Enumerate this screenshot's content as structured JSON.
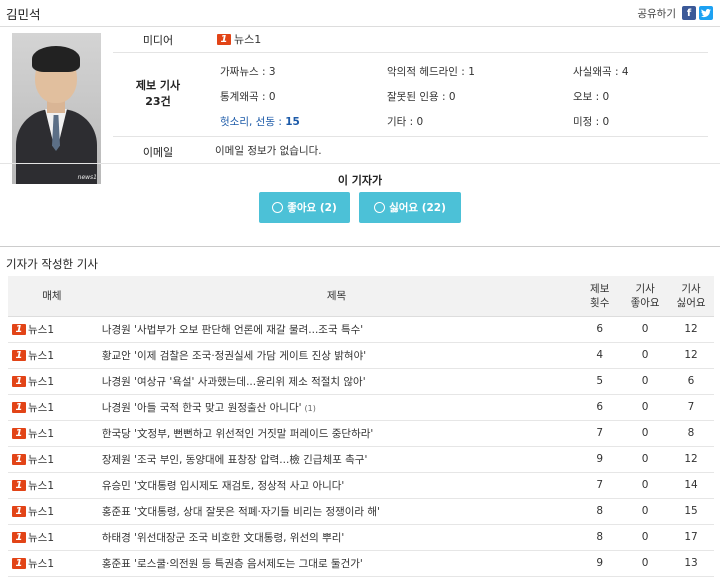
{
  "reporter": {
    "name": "김민석"
  },
  "share": {
    "label": "공유하기",
    "facebook_icon": "f",
    "twitter_icon": "t"
  },
  "profile": {
    "photo_watermark": "news1",
    "media_label": "미디어",
    "media_name": "뉴스1",
    "report_label_line1": "제보 기사",
    "report_count": "23건",
    "email_label": "이메일",
    "email_value": "이메일 정보가 없습니다."
  },
  "stats": [
    {
      "label": "가짜뉴스",
      "value": "3"
    },
    {
      "label": "악의적 헤드라인",
      "value": "1"
    },
    {
      "label": "사실왜곡",
      "value": "4"
    },
    {
      "label": "통계왜곡",
      "value": "0"
    },
    {
      "label": "잘못된 인용",
      "value": "0"
    },
    {
      "label": "오보",
      "value": "0"
    },
    {
      "label": "헛소리, 선동",
      "value": "15"
    },
    {
      "label": "기타",
      "value": "0"
    },
    {
      "label": "미정",
      "value": "0"
    }
  ],
  "feedback": {
    "title": "이 기자가",
    "like_label": "좋아요 (2)",
    "dislike_label": "싫어요 (22)"
  },
  "articles_section": {
    "title": "기자가 작성한 기사",
    "headers": {
      "media": "매체",
      "title": "제목",
      "reports_l1": "제보",
      "reports_l2": "횟수",
      "likes_l1": "기사",
      "likes_l2": "좋아요",
      "dislikes_l1": "기사",
      "dislikes_l2": "싫어요"
    },
    "rows": [
      {
        "media": "뉴스1",
        "title": "나경원 '사법부가 오보 판단해 언론에 재갈 물려...조국 특수'",
        "reports": "6",
        "likes": "0",
        "dislikes": "12"
      },
      {
        "media": "뉴스1",
        "title": "황교안 '이제 검찰은 조국·정권실세 가담 게이트 진상 밝혀야'",
        "reports": "4",
        "likes": "0",
        "dislikes": "12"
      },
      {
        "media": "뉴스1",
        "title": "나경원 '여상규 '욕설' 사과했는데...윤리위 제소 적절치 않아'",
        "reports": "5",
        "likes": "0",
        "dislikes": "6"
      },
      {
        "media": "뉴스1",
        "title": "나경원 '아들 국적 한국 맞고 원정출산 아니다'",
        "comment": "(1)",
        "reports": "6",
        "likes": "0",
        "dislikes": "7"
      },
      {
        "media": "뉴스1",
        "title": "한국당 '文정부, 뻔뻔하고 위선적인 거짓말 퍼레이드 중단하라'",
        "reports": "7",
        "likes": "0",
        "dislikes": "8"
      },
      {
        "media": "뉴스1",
        "title": "장제원 '조국 부인, 동양대에 표창장 압력...檢 긴급체포 촉구'",
        "reports": "9",
        "likes": "0",
        "dislikes": "12"
      },
      {
        "media": "뉴스1",
        "title": "유승민 '文대통령 입시제도 재검토, 정상적 사고 아니다'",
        "reports": "7",
        "likes": "0",
        "dislikes": "14"
      },
      {
        "media": "뉴스1",
        "title": "홍준표 '文대통령, 상대 잘못은 적폐·자기들 비리는 정쟁이라 해'",
        "reports": "8",
        "likes": "0",
        "dislikes": "15"
      },
      {
        "media": "뉴스1",
        "title": "하태경 '위선대장군 조국 비호한 文대통령, 위선의 뿌리'",
        "reports": "8",
        "likes": "0",
        "dislikes": "17"
      },
      {
        "media": "뉴스1",
        "title": "홍준표 '로스쿨·의전원 등 특권층 음서제도는 그대로 둘건가'",
        "reports": "9",
        "likes": "0",
        "dislikes": "13"
      }
    ]
  },
  "colors": {
    "accent": "#4cc1d7",
    "news1": "#e24417",
    "highlight": "#1c5aa8"
  }
}
